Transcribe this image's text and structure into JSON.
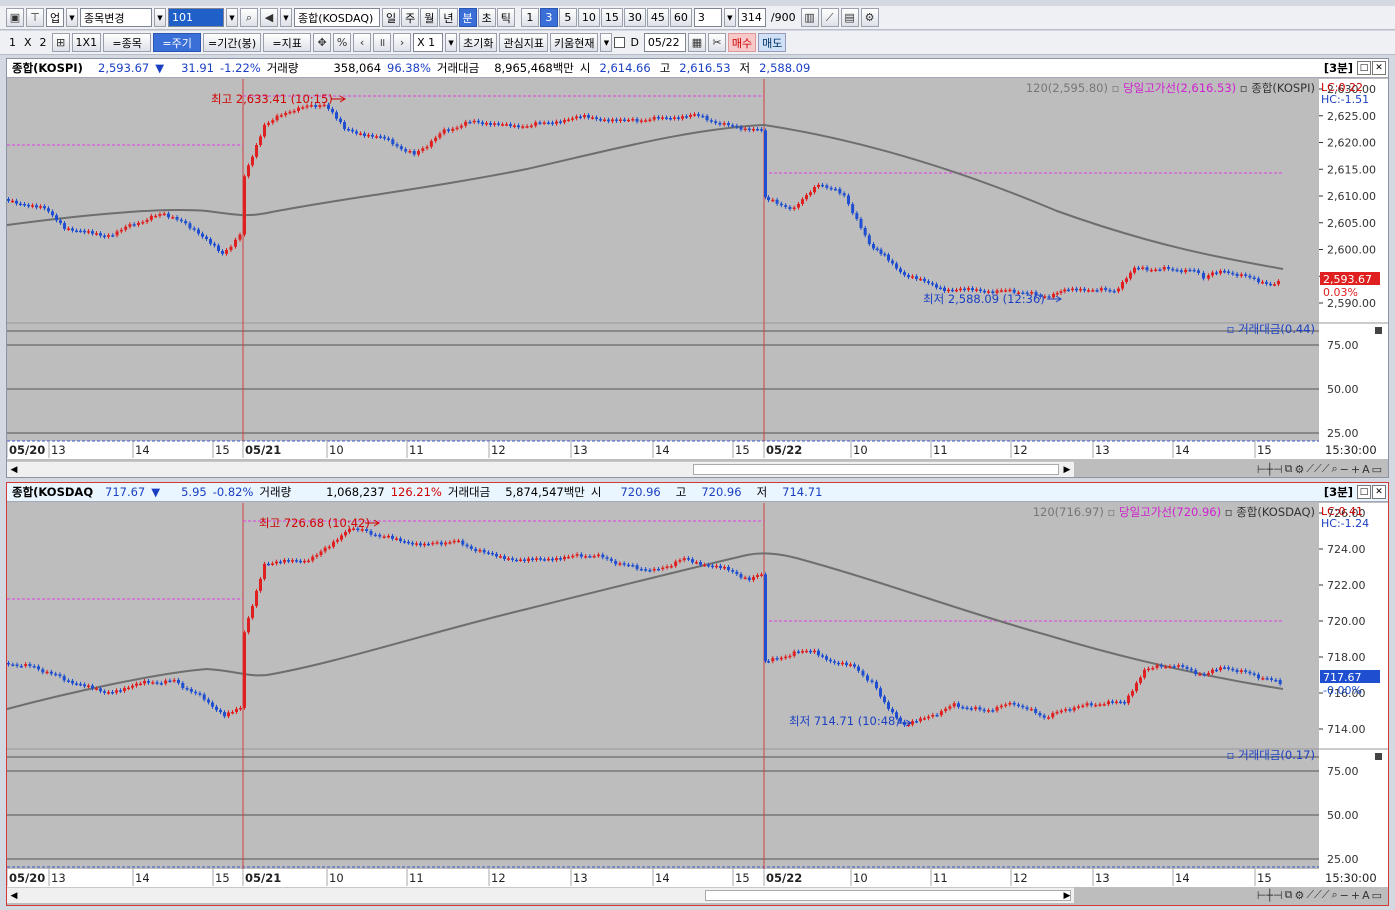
{
  "toolbar1": {
    "market": "업",
    "change_item": "종목변경",
    "code": "101",
    "index_name": "종합(KOSDAQ)",
    "periods": [
      "일",
      "주",
      "월",
      "년",
      "분",
      "초",
      "틱"
    ],
    "active_period": "분",
    "minutes": [
      "1",
      "3",
      "5",
      "10",
      "15",
      "30",
      "45",
      "60"
    ],
    "active_minute": "3",
    "interval_value": "3",
    "count": "314",
    "count_max": "/900"
  },
  "toolbar2": {
    "layout": [
      "1",
      "X",
      "2"
    ],
    "grid_1x1": "1X1",
    "item_btn": "=종목",
    "cycle_btn": "=주기",
    "range_btn": "=기간(봉)",
    "indicator_btn": "=지표",
    "percent": "%",
    "zoom": "X 1",
    "reset": "초기화",
    "interest": "관심지표",
    "price_now": "키움현재",
    "d_label": "D",
    "date": "05/22",
    "buy": "매수",
    "sell": "매도"
  },
  "panel1": {
    "name": "종합(KOSPI)",
    "price": "2,593.67",
    "arrow": "▼",
    "change": "31.91",
    "change_pct": "-1.22%",
    "volume_label": "거래량",
    "volume": "358,064",
    "volume_pct": "96.38%",
    "amount_label": "거래대금",
    "amount": "8,965,468백만",
    "open_label": "시",
    "open": "2,614.66",
    "high_label": "고",
    "high": "2,616.53",
    "low_label": "저",
    "low": "2,588.09",
    "period_tag": "[3분]",
    "legend_ma": "120(2,595.80)",
    "legend_high": "당일고가선(2,616.53)",
    "legend_name": "종합(KOSPI)",
    "lc": "LC:0.22",
    "hc": "HC:-1.51",
    "max_annot": "최고 2,633.41 (10:15)",
    "min_annot": "최저 2,588.09 (12:36)",
    "last_price_tag": "2,593.67",
    "last_pct_tag": "0.03%",
    "sub_legend": "거래대금(0.44)",
    "y_ticks": [
      "2,630.00",
      "2,625.00",
      "2,620.00",
      "2,615.00",
      "2,610.00",
      "2,605.00",
      "2,600.00",
      "2,595.00",
      "2,590.00"
    ],
    "sub_ticks": [
      "75.00",
      "50.00",
      "25.00"
    ],
    "x_labels": [
      "05/20",
      "13",
      "14",
      "15",
      "05/21",
      "10",
      "11",
      "12",
      "13",
      "14",
      "15",
      "05/22",
      "10",
      "11",
      "12",
      "13",
      "14",
      "15"
    ],
    "time_label": "15:30:00"
  },
  "panel2": {
    "name": "종합(KOSDAQ",
    "price": "717.67",
    "arrow": "▼",
    "change": "5.95",
    "change_pct": "-0.82%",
    "volume_label": "거래량",
    "volume": "1,068,237",
    "volume_pct": "126.21%",
    "amount_label": "거래대금",
    "amount": "5,874,547백만",
    "open_label": "시",
    "open": "720.96",
    "high_label": "고",
    "high": "720.96",
    "low_label": "저",
    "low": "714.71",
    "period_tag": "[3분]",
    "legend_ma": "120(716.97)",
    "legend_high": "당일고가선(720.96)",
    "legend_name": "종합(KOSDAQ)",
    "lc": "LC:0.41",
    "hc": "HC:-1.24",
    "max_annot": "최고 726.68 (10:42)",
    "min_annot": "최저 714.71 (10:48)",
    "last_price_tag": "717.67",
    "last_pct_tag": "-0.00%",
    "sub_legend": "거래대금(0.17)",
    "y_ticks": [
      "726.00",
      "724.00",
      "722.00",
      "720.00",
      "718.00",
      "716.00",
      "714.00"
    ],
    "sub_ticks": [
      "75.00",
      "50.00",
      "25.00"
    ],
    "x_labels": [
      "05/20",
      "13",
      "14",
      "15",
      "05/21",
      "10",
      "11",
      "12",
      "13",
      "14",
      "15",
      "05/22",
      "10",
      "11",
      "12",
      "13",
      "14",
      "15"
    ],
    "time_label": "15:30:00"
  },
  "colors": {
    "up": "#e02020",
    "down": "#1f4fd0",
    "ma": "#6e6e6e",
    "highline": "#e040e0",
    "daysep": "#d04040"
  }
}
